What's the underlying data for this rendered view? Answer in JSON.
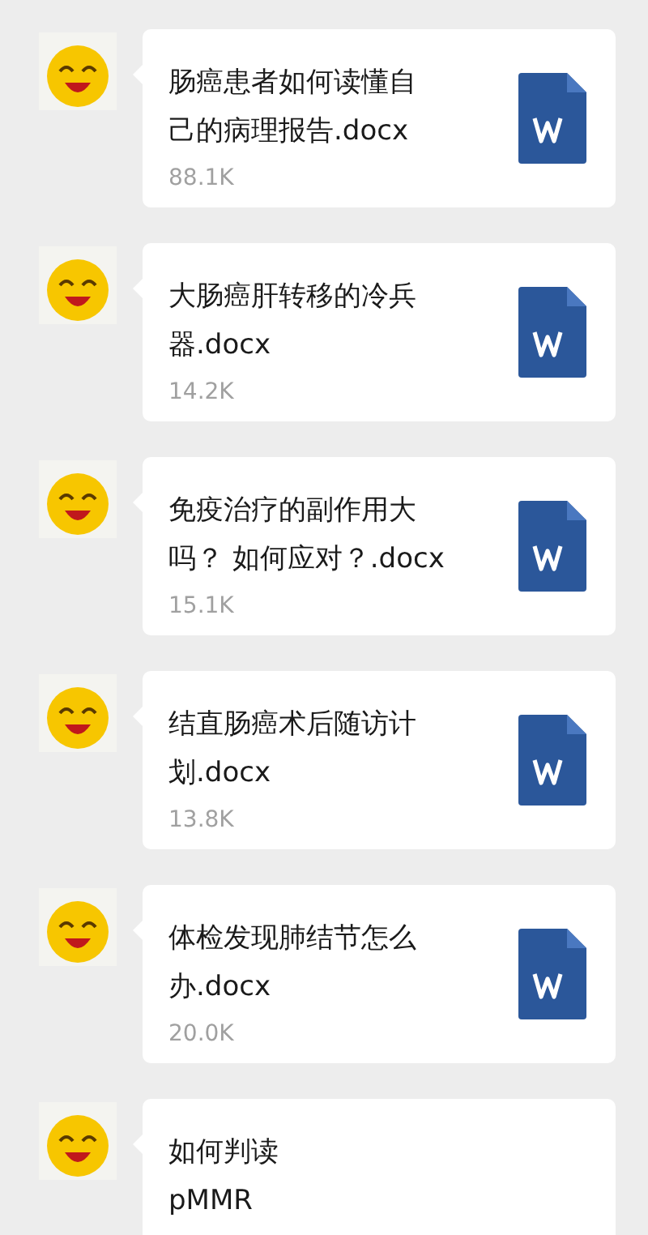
{
  "messages": [
    {
      "title_lines": [
        "肠癌患者如何读懂自",
        "己的病理报告.docx"
      ],
      "size": "88.1K",
      "file_icon": true
    },
    {
      "title_lines": [
        "大肠癌肝转移的冷兵",
        "器.docx"
      ],
      "size": "14.2K",
      "file_icon": true
    },
    {
      "title_lines": [
        "免疫治疗的副作用大",
        "吗？ 如何应对？.docx"
      ],
      "size": "15.1K",
      "file_icon": true
    },
    {
      "title_lines": [
        "结直肠癌术后随访计",
        "划.docx"
      ],
      "size": "13.8K",
      "file_icon": true
    },
    {
      "title_lines": [
        "体检发现肺结节怎么",
        "办.docx"
      ],
      "size": "20.0K",
      "file_icon": true
    },
    {
      "title_lines": [
        "如何判读",
        "pMMR"
      ],
      "file_icon": false
    }
  ]
}
